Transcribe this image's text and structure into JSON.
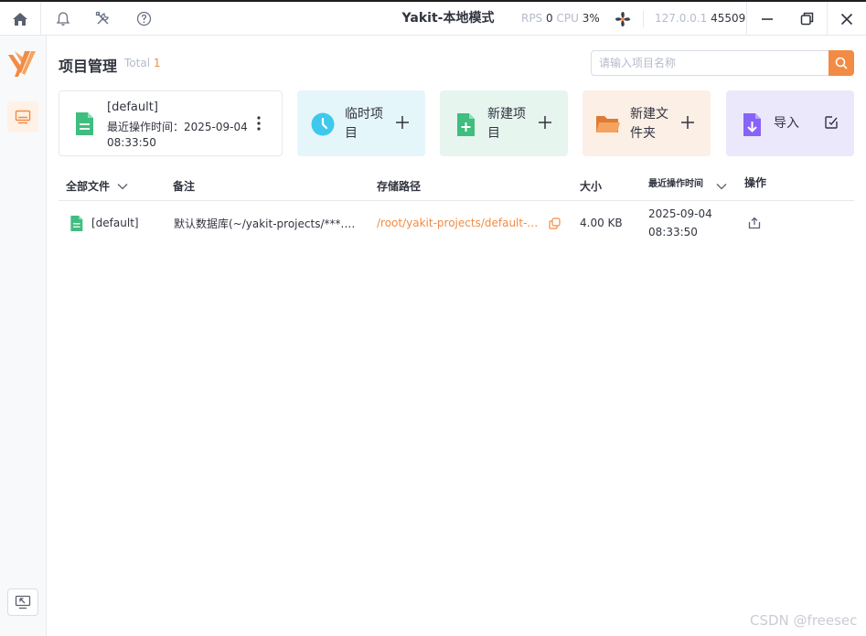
{
  "titlebar": {
    "title": "Yakit-本地模式",
    "rps_label": "RPS",
    "rps_value": "0",
    "cpu_label": "CPU",
    "cpu_value": "3%",
    "host": "127.0.0.1",
    "port": "45509",
    "icons": [
      "home-icon",
      "bell-icon",
      "tools-icon",
      "help-icon",
      "engine-icon",
      "minimize-icon",
      "restore-icon",
      "close-icon"
    ]
  },
  "sidebar": {
    "logo": "yakit-logo",
    "active_icon": "monitor-icon",
    "bottom_icon": "screen-collapse-icon",
    "accent": "#f28b44"
  },
  "header": {
    "title": "项目管理",
    "total_label": "Total",
    "total_value": "1",
    "search_placeholder": "请输入项目名称"
  },
  "cards": {
    "default": {
      "name": "[default]",
      "time_label": "最近操作时间：2025-09-04 08:33:50"
    },
    "temp": {
      "label": "临时项目"
    },
    "new_project": {
      "label": "新建项目"
    },
    "new_folder": {
      "label": "新建文件夹"
    },
    "import": {
      "label": "导入"
    }
  },
  "table": {
    "columns": {
      "name": "全部文件",
      "note": "备注",
      "path": "存储路径",
      "size": "大小",
      "time": "最近操作时间",
      "op": "操作"
    },
    "rows": [
      {
        "name": "[default]",
        "note": "默认数据库(~/yakit-projects/***.db): 该数据库包含Yakit的默认配置",
        "path": "/root/yakit-projects/default-yakit.db",
        "size": "4.00 KB",
        "time": "2025-09-04 08:33:50"
      }
    ]
  },
  "watermark": "CSDN @freesec"
}
